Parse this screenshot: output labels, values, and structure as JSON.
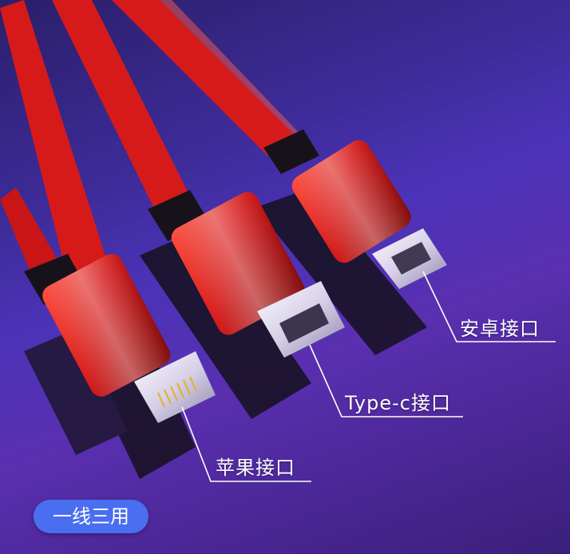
{
  "callouts": {
    "android": "安卓接口",
    "typec": "Type-c接口",
    "lightning": "苹果接口"
  },
  "badge": {
    "label": "一线三用"
  },
  "colors": {
    "cable_red": "#d61a1a",
    "badge_blue": "#4a6ef0",
    "background_purple": "#4b33b8"
  }
}
